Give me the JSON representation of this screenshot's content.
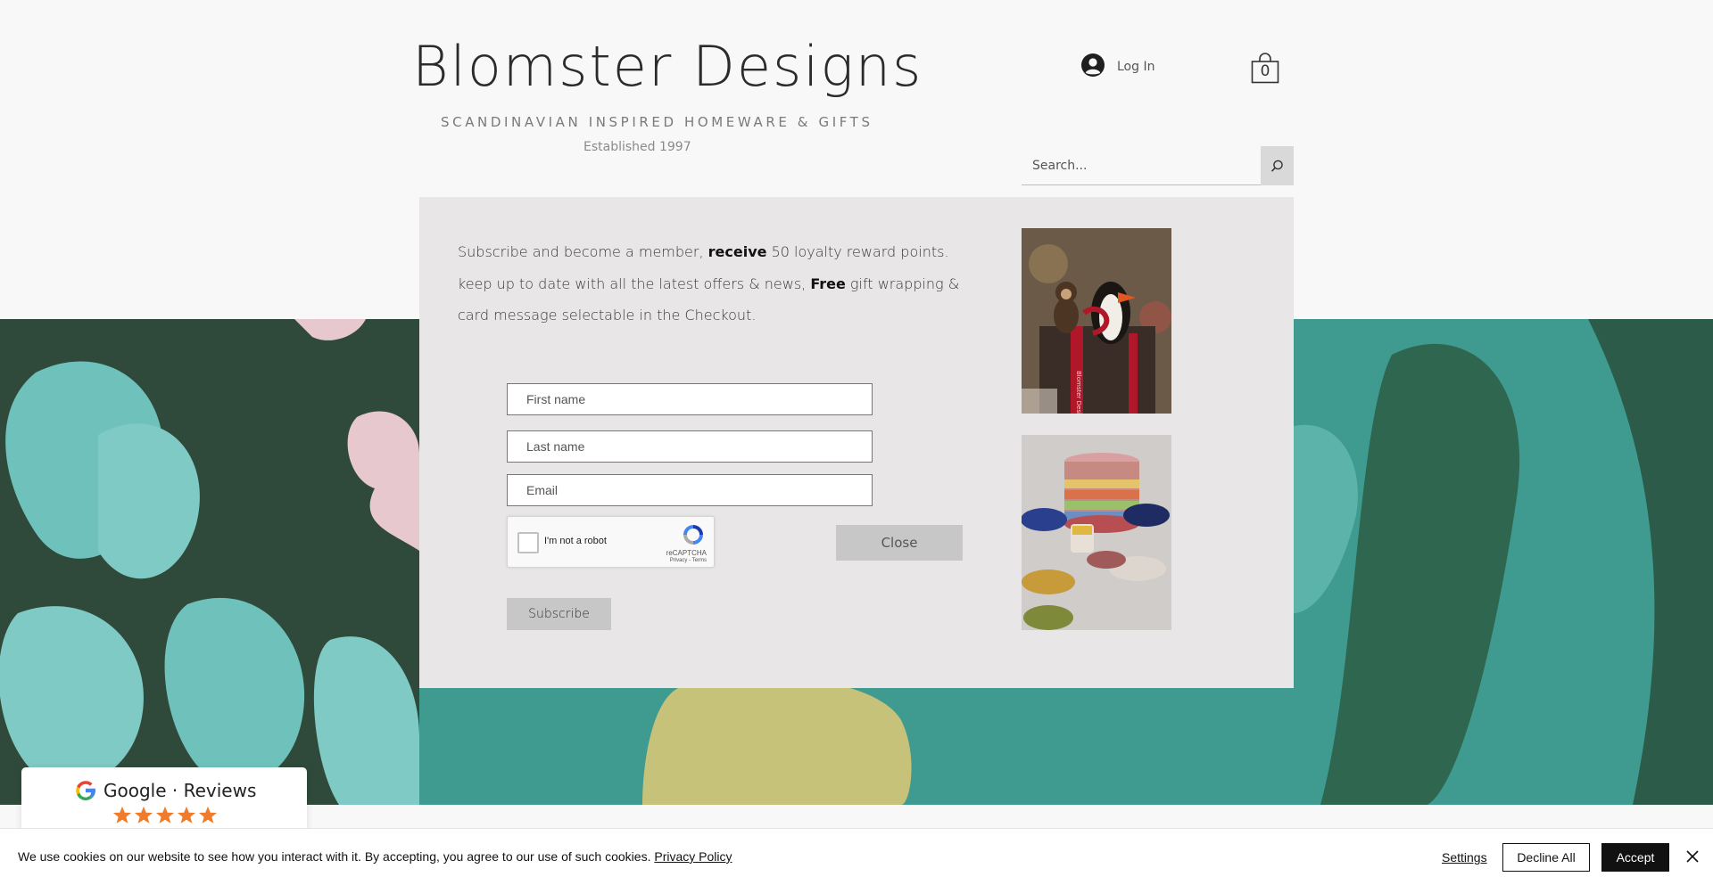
{
  "header": {
    "brand_title": "Blomster Designs",
    "tagline": "SCANDINAVIAN INSPIRED HOMEWARE & GIFTS",
    "established": "Established 1997",
    "login_label": "Log In",
    "cart_count": "0",
    "search_placeholder": "Search..."
  },
  "popup": {
    "line1_a": "Subscribe and become a member, ",
    "line1_bold": "receive",
    "line1_b": " 50 loyalty reward points.",
    "line2_a": "keep up to date with all the latest offers & news, ",
    "line2_bold": "Free",
    "line2_b": " gift wrapping & card message selectable in the Checkout.",
    "first_name_placeholder": "First name",
    "last_name_placeholder": "Last name",
    "email_placeholder": "Email",
    "recaptcha_label": "I'm not a robot",
    "recaptcha_brand": "reCAPTCHA",
    "recaptcha_links": "Privacy - Terms",
    "close_label": "Close",
    "subscribe_label": "Subscribe",
    "photo1_box_text": "Blomster Designs"
  },
  "reviews": {
    "title": "Google · Reviews",
    "rating": 5
  },
  "cookie": {
    "text": "We use cookies on our website to see how you interact with it. By accepting, you agree to our use of such cookies. ",
    "policy_link": "Privacy Policy",
    "settings_label": "Settings",
    "decline_label": "Decline All",
    "accept_label": "Accept"
  },
  "colors": {
    "hero_teal": "#3f9a90",
    "hero_dark_green": "#2f4a3a",
    "popup_bg": "#e8e6e6",
    "star_orange": "#f07b2a"
  },
  "icons": {
    "account": "account-circle-icon",
    "cart": "shopping-bag-icon",
    "search": "search-icon",
    "google": "google-g-icon",
    "star": "star-icon",
    "close": "close-icon"
  }
}
